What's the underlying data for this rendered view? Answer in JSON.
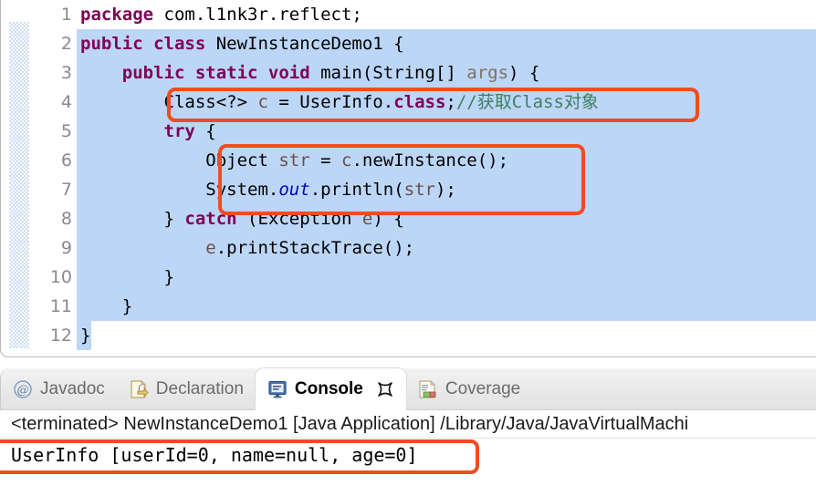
{
  "editor": {
    "fold_line": 3,
    "lines": [
      {
        "n": "1",
        "selected": "none"
      },
      {
        "n": "2",
        "selected": "full"
      },
      {
        "n": "3",
        "selected": "full"
      },
      {
        "n": "4",
        "selected": "full"
      },
      {
        "n": "5",
        "selected": "full"
      },
      {
        "n": "6",
        "selected": "full"
      },
      {
        "n": "7",
        "selected": "full"
      },
      {
        "n": "8",
        "selected": "full"
      },
      {
        "n": "9",
        "selected": "full"
      },
      {
        "n": "10",
        "selected": "full"
      },
      {
        "n": "11",
        "selected": "full"
      },
      {
        "n": "12",
        "selected": "partial"
      }
    ],
    "code": {
      "l1_kw": "package",
      "l1_rest": " com.l1nk3r.reflect;",
      "l2_kw": "public class",
      "l2_rest": " NewInstanceDemo1 {",
      "l3_indent": "    ",
      "l3_kw": "public static void",
      "l3_mid": " main(String[] ",
      "l3_param": "args",
      "l3_end": ") {",
      "l4_indent": "        ",
      "l4_a": "Class<?> ",
      "l4_var": "c",
      "l4_b": " = UserInfo.",
      "l4_kw": "class",
      "l4_c": ";",
      "l4_comment": "//获取Class对象",
      "l5_indent": "        ",
      "l5_kw": "try",
      "l5_end": " {",
      "l6_indent": "            ",
      "l6_a": "Object ",
      "l6_var": "str",
      "l6_b": " = ",
      "l6_var2": "c",
      "l6_c": ".newInstance();",
      "l7_indent": "            ",
      "l7_a": "System.",
      "l7_fld": "out",
      "l7_b": ".println(",
      "l7_var": "str",
      "l7_c": ");",
      "l8_indent": "        ",
      "l8_a": "} ",
      "l8_kw": "catch",
      "l8_b": " (Exception ",
      "l8_var": "e",
      "l8_c": ") {",
      "l9_indent": "            ",
      "l9_var": "e",
      "l9_rest": ".printStackTrace();",
      "l10": "        }",
      "l11": "    }",
      "l12": "}"
    }
  },
  "bottom_view": {
    "tabs": [
      {
        "label": "Javadoc",
        "icon": "at-sign-icon",
        "active": false
      },
      {
        "label": "Declaration",
        "icon": "declaration-icon",
        "active": false
      },
      {
        "label": "Console",
        "icon": "console-icon",
        "active": true
      },
      {
        "label": "Coverage",
        "icon": "coverage-icon",
        "active": false
      }
    ],
    "close_icon": "close-icon",
    "console": {
      "terminated_line": "<terminated> NewInstanceDemo1 [Java Application] /Library/Java/JavaVirtualMachi",
      "output_line": "UserInfo [userId=0, name=null, age=0]"
    }
  },
  "annotations": {
    "accent_color": "#ef4c23",
    "count": 3
  },
  "colors": {
    "selection": "#bcd6f7",
    "keyword": "#7f0055",
    "comment": "#3f7f5f",
    "variable": "#6a5049",
    "static_field": "#0000c0",
    "line_number": "#8a8a8a"
  }
}
